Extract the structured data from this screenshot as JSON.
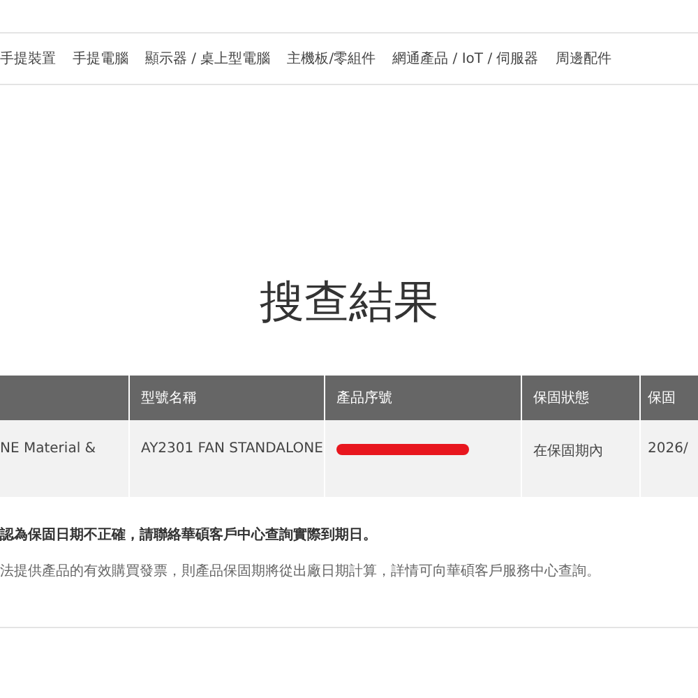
{
  "nav": [
    "手提裝置",
    "手提電腦",
    "顯示器 / 桌上型電腦",
    "主機板/零組件",
    "網通產品 / IoT / 伺服器",
    "周邊配件"
  ],
  "title": "搜查結果",
  "table": {
    "columns": [
      "",
      "型號名稱",
      "產品序號",
      "保固狀態",
      "保固"
    ],
    "rows": [
      {
        "cells": [
          "NE Material &",
          "AY2301 FAN STANDALONE",
          "",
          "在保固期內",
          "2026/"
        ],
        "serial_redacted": true
      }
    ]
  },
  "notes": [
    {
      "kind": "bold",
      "text": "認為保固日期不正確，請聯絡華碩客戶中心查詢實際到期日。"
    },
    {
      "kind": "small",
      "text": "法提供產品的有效購買發票，則產品保固期將從出廠日期計算，詳情可向華碩客戶服務中心查詢。"
    }
  ]
}
